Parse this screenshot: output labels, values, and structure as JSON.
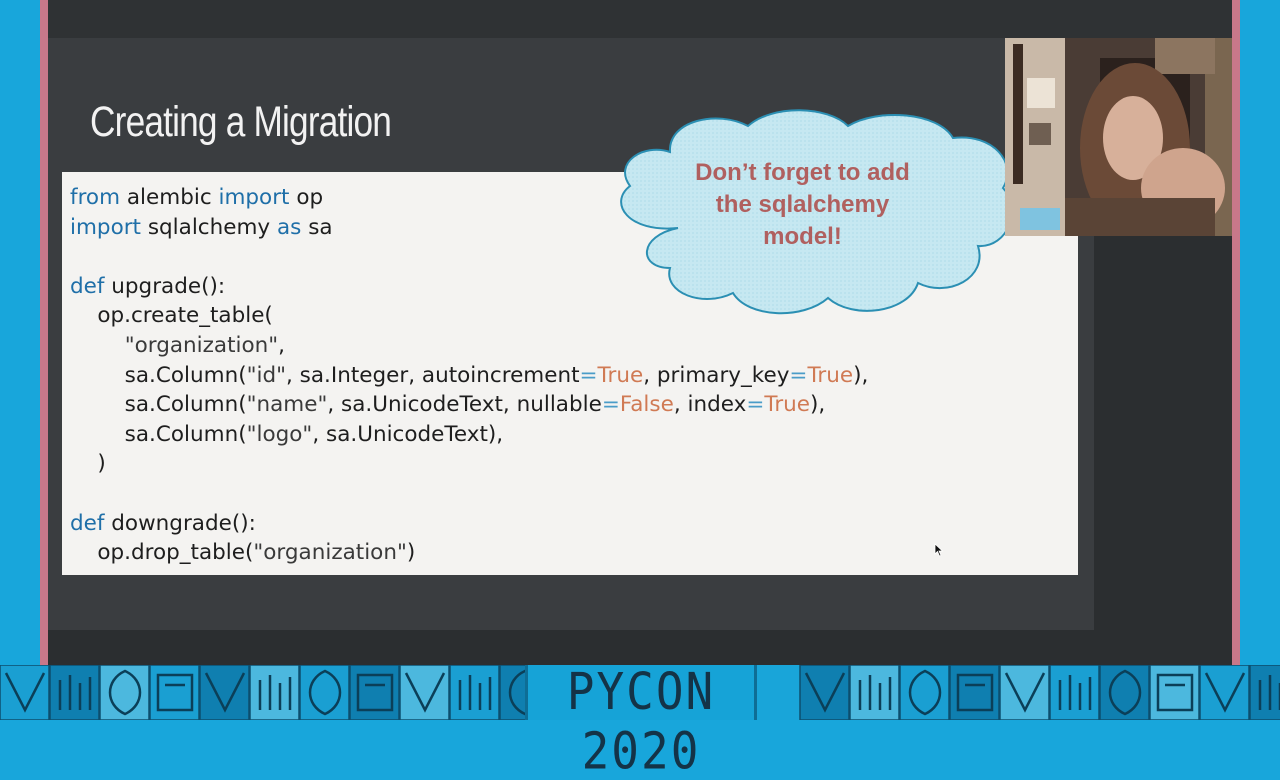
{
  "slide": {
    "title": "Creating a Migration",
    "code_lines": [
      [
        {
          "t": "from",
          "c": "kw"
        },
        {
          "t": " alembic ",
          "c": ""
        },
        {
          "t": "import",
          "c": "kw"
        },
        {
          "t": " op",
          "c": ""
        }
      ],
      [
        {
          "t": "import",
          "c": "kw"
        },
        {
          "t": " sqlalchemy ",
          "c": ""
        },
        {
          "t": "as",
          "c": "kw"
        },
        {
          "t": " sa",
          "c": ""
        }
      ],
      [],
      [
        {
          "t": "def",
          "c": "kw"
        },
        {
          "t": " upgrade():",
          "c": ""
        }
      ],
      [
        {
          "t": "    op.create_table(",
          "c": ""
        }
      ],
      [
        {
          "t": "        ",
          "c": ""
        },
        {
          "t": "\"organization\"",
          "c": "str"
        },
        {
          "t": ",",
          "c": ""
        }
      ],
      [
        {
          "t": "        sa.Column(",
          "c": ""
        },
        {
          "t": "\"id\"",
          "c": "str"
        },
        {
          "t": ", sa.Integer, autoincrement",
          "c": ""
        },
        {
          "t": "=",
          "c": "op"
        },
        {
          "t": "True",
          "c": "bool"
        },
        {
          "t": ", primary_key",
          "c": ""
        },
        {
          "t": "=",
          "c": "op"
        },
        {
          "t": "True",
          "c": "bool"
        },
        {
          "t": "),",
          "c": ""
        }
      ],
      [
        {
          "t": "        sa.Column(",
          "c": ""
        },
        {
          "t": "\"name\"",
          "c": "str"
        },
        {
          "t": ", sa.UnicodeText, nullable",
          "c": ""
        },
        {
          "t": "=",
          "c": "op"
        },
        {
          "t": "False",
          "c": "bool"
        },
        {
          "t": ", index",
          "c": ""
        },
        {
          "t": "=",
          "c": "op"
        },
        {
          "t": "True",
          "c": "bool"
        },
        {
          "t": "),",
          "c": ""
        }
      ],
      [
        {
          "t": "        sa.Column(",
          "c": ""
        },
        {
          "t": "\"logo\"",
          "c": "str"
        },
        {
          "t": ", sa.UnicodeText),",
          "c": ""
        }
      ],
      [
        {
          "t": "    )",
          "c": ""
        }
      ],
      [],
      [
        {
          "t": "def",
          "c": "kw"
        },
        {
          "t": " downgrade():",
          "c": ""
        }
      ],
      [
        {
          "t": "    op.drop_table(",
          "c": ""
        },
        {
          "t": "\"organization\"",
          "c": "str"
        },
        {
          "t": ")",
          "c": ""
        }
      ]
    ],
    "callout_lines": [
      "Don’t forget to add",
      "the sqlalchemy",
      "model!"
    ]
  },
  "footer": {
    "logo_text": "PYCON 2020"
  },
  "colors": {
    "background": "#18a6db",
    "slide_bg": "#3a3d40",
    "code_bg": "#f4f3f1",
    "keyword": "#1f6fa8",
    "boolean": "#d07a54",
    "callout_text": "#b0605f",
    "cloud_fill": "#c8e9f2"
  }
}
